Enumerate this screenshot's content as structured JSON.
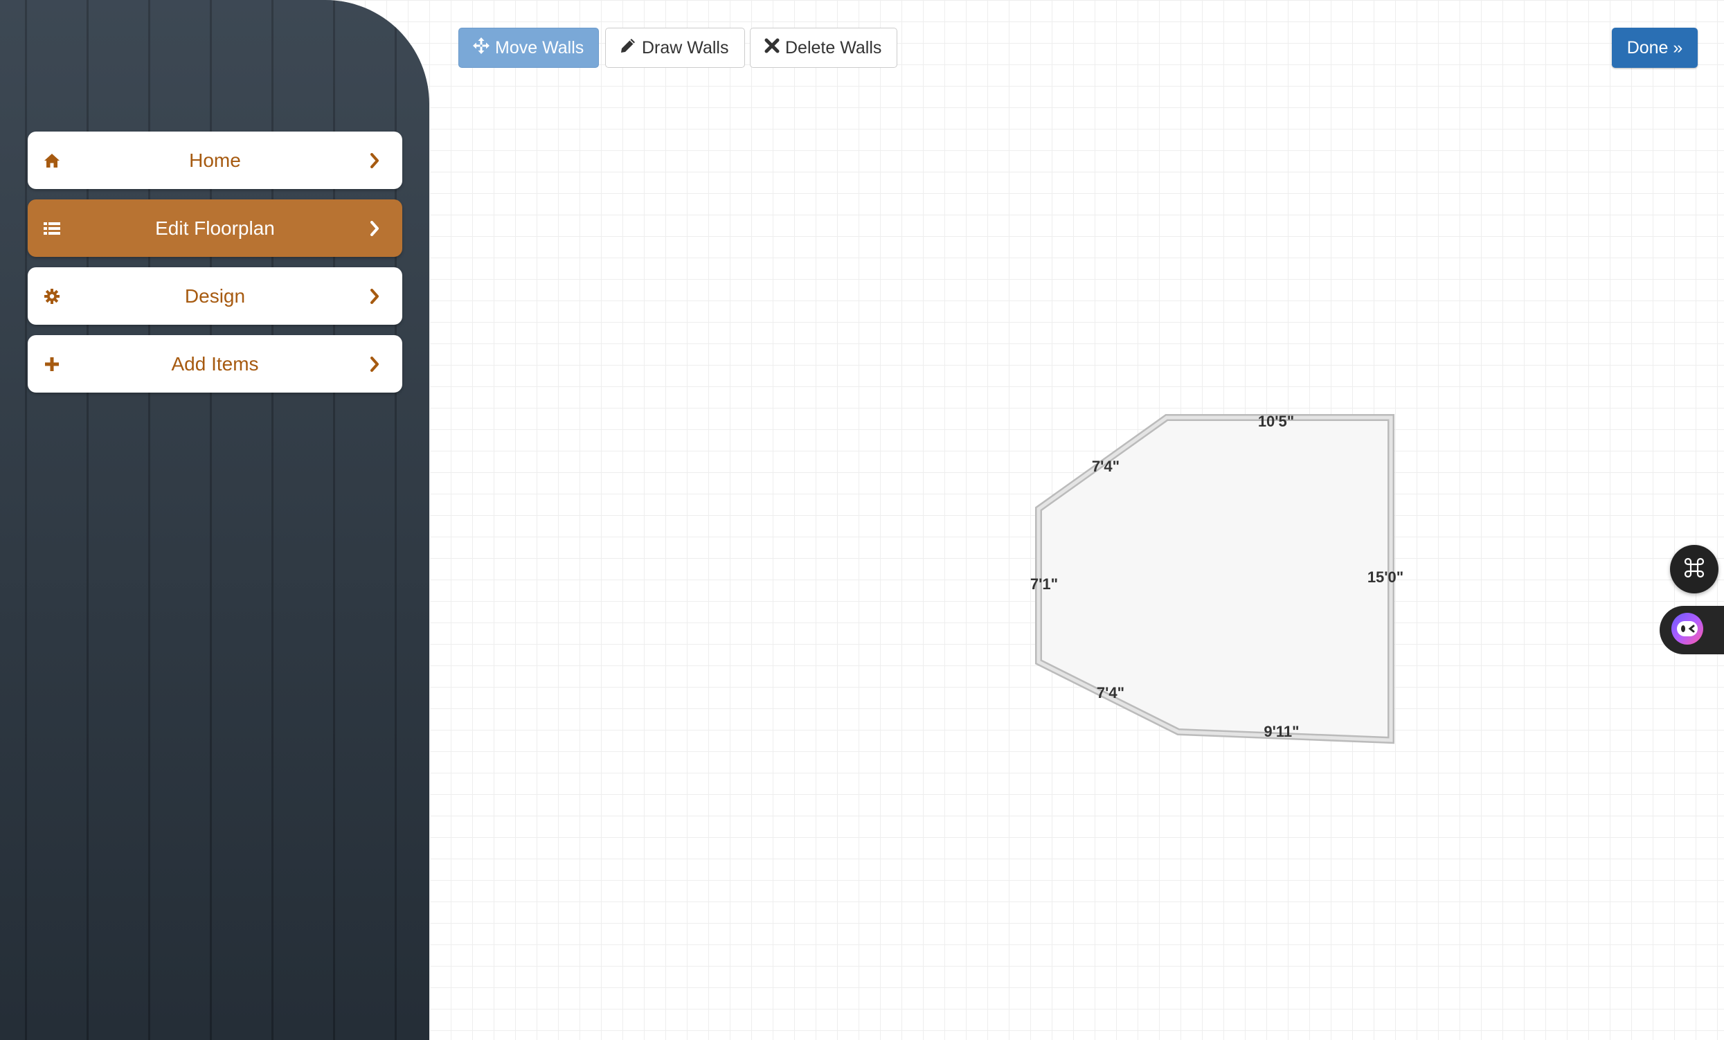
{
  "sidebar": {
    "items": [
      {
        "label": "Home",
        "icon": "home-icon",
        "active": false
      },
      {
        "label": "Edit Floorplan",
        "icon": "list-icon",
        "active": true
      },
      {
        "label": "Design",
        "icon": "gear-icon",
        "active": false
      },
      {
        "label": "Add Items",
        "icon": "plus-icon",
        "active": false
      }
    ]
  },
  "toolbar": {
    "move_walls": "Move Walls",
    "draw_walls": "Draw Walls",
    "delete_walls": "Delete Walls",
    "done": "Done »"
  },
  "floorplan": {
    "walls": [
      {
        "name": "top",
        "length": "10'5\""
      },
      {
        "name": "right",
        "length": "15'0\""
      },
      {
        "name": "bottom",
        "length": "9'11\""
      },
      {
        "name": "bottom-left-diagonal",
        "length": "7'4\""
      },
      {
        "name": "left",
        "length": "7'1\""
      },
      {
        "name": "top-left-diagonal",
        "length": "7'4\""
      }
    ]
  },
  "colors": {
    "accent": "#b87332",
    "nav_text": "#a65a10",
    "primary_button": "#2a6fb4",
    "active_tool": "#7aa8d7",
    "sidebar_bg": "#2e3a46"
  }
}
